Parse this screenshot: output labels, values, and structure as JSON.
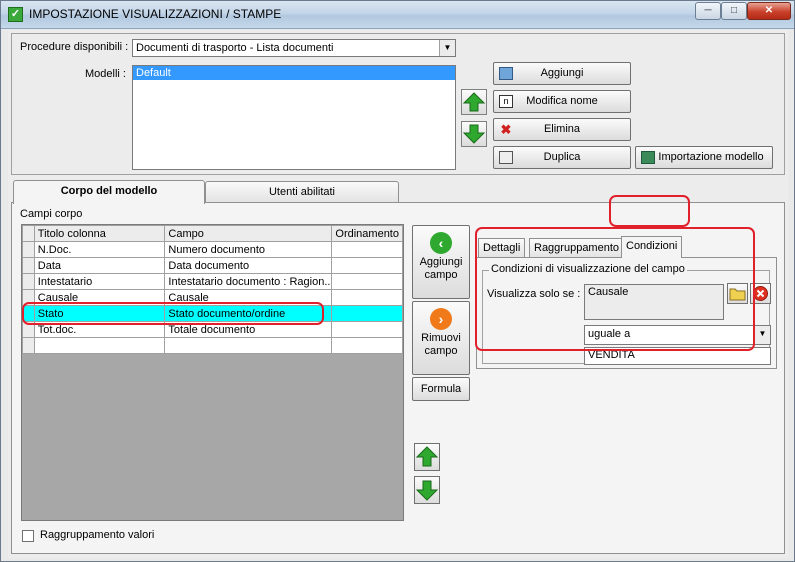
{
  "window": {
    "title": "IMPOSTAZIONE VISUALIZZAZIONI / STAMPE",
    "min_glyph": "─",
    "max_glyph": "□",
    "close_glyph": "✕"
  },
  "procedure": {
    "label": "Procedure disponibili :",
    "selected": "Documenti di trasporto - Lista documenti"
  },
  "modelli": {
    "label": "Modelli :",
    "items": [
      "Default"
    ]
  },
  "model_buttons": {
    "aggiungi": "Aggiungi",
    "modifica_nome": "Modifica nome",
    "elimina": "Elimina",
    "duplica": "Duplica",
    "importazione": "Importazione modello"
  },
  "tabs": {
    "corpo": "Corpo del modello",
    "utenti": "Utenti abilitati"
  },
  "campi_corpo": {
    "label": "Campi corpo",
    "headers": [
      "Titolo colonna",
      "Campo",
      "Ordinamento"
    ],
    "rows": [
      [
        "N.Doc.",
        "Numero documento",
        ""
      ],
      [
        "Data",
        "Data documento",
        ""
      ],
      [
        "Intestatario",
        "Intestatario documento : Ragion...",
        ""
      ],
      [
        "Causale",
        "Causale",
        ""
      ],
      [
        "Stato",
        "Stato documento/ordine",
        ""
      ],
      [
        "Tot.doc.",
        "Totale documento",
        ""
      ],
      [
        "",
        "",
        ""
      ]
    ],
    "selected_row": 4
  },
  "side_buttons": {
    "aggiungi_campo": "Aggiungi campo",
    "rimuovi_campo": "Rimuovi campo",
    "formula": "Formula"
  },
  "raggruppamento_valori": "Raggruppamento valori",
  "subtabs": {
    "dettagli": "Dettagli",
    "raggruppamento": "Raggruppamento",
    "condizioni": "Condizioni"
  },
  "condizioni": {
    "group_title": "Condizioni di visualizzazione del campo",
    "visualizza_label": "Visualizza solo se :",
    "campo": "Causale",
    "operatore": "uguale a",
    "valore": "VENDITA"
  },
  "colors": {
    "selected_row": "#00ffff",
    "highlight": "#e0202a",
    "list_selection": "#3399ff"
  }
}
